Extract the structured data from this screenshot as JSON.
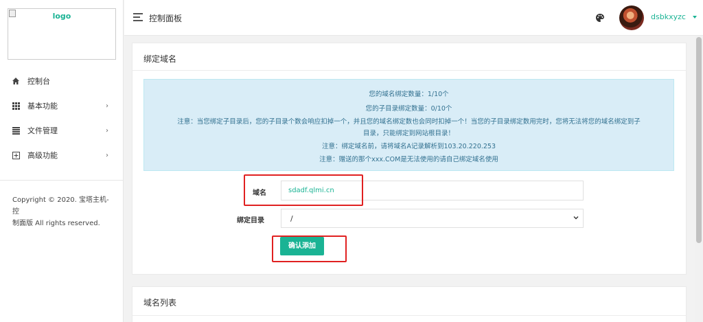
{
  "sidebar": {
    "logo_alt": "logo",
    "items": [
      {
        "label": "控制台",
        "icon": "home-icon"
      },
      {
        "label": "基本功能",
        "icon": "grid-icon",
        "chevron": "›"
      },
      {
        "label": "文件管理",
        "icon": "list-icon",
        "chevron": "›"
      },
      {
        "label": "高级功能",
        "icon": "plus-square-icon",
        "chevron": "›"
      }
    ],
    "copyright_line1": "Copyright © 2020. 宝塔主机-控",
    "copyright_line2": "制面版 All rights reserved."
  },
  "header": {
    "title": "控制面板",
    "username": "dsbkxyzc"
  },
  "card": {
    "title": "绑定域名",
    "alert": [
      "您的域名绑定数量：1/10个",
      "您的子目录绑定数量：0/10个",
      "注意：当您绑定子目录后，您的子目录个数会响应扣掉一个，并且您的域名绑定数也会同时扣掉一个！当您的子目录绑定数用完时，您将无法将您的域名绑定到子",
      "目录，只能绑定到网站根目录！",
      "注意：绑定域名前，请将域名A记录解析到103.20.220.253",
      "注意：赠送的那个xxx.COM是无法使用的请自己绑定域名使用"
    ],
    "domain_label": "域名",
    "domain_value": "sdadf.qlmi.cn",
    "dir_label": "绑定目录",
    "dir_value": "/",
    "submit_label": "确认添加"
  },
  "card2": {
    "title": "域名列表"
  },
  "colors": {
    "accent": "#1ab394",
    "highlight": "#e02020",
    "alert_bg": "#d9edf7",
    "alert_text": "#31708f"
  }
}
